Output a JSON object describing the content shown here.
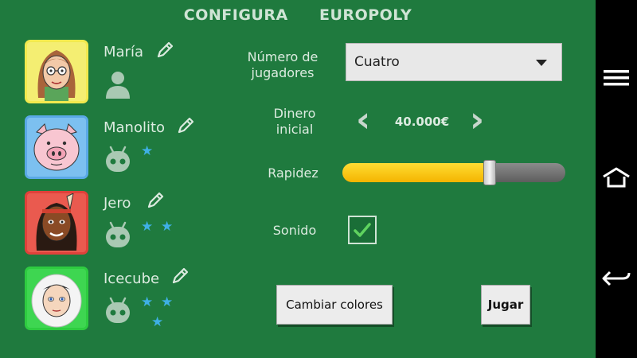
{
  "title": "CONFIGURA   EUROPOLY",
  "players": [
    {
      "name": "María",
      "type": "human",
      "stars": 0,
      "border_color": "#f2e94e"
    },
    {
      "name": "Manolito",
      "type": "cpu",
      "stars": 1,
      "border_color": "#5aa9e6"
    },
    {
      "name": "Jero",
      "type": "cpu",
      "stars": 2,
      "border_color": "#e0413a"
    },
    {
      "name": "Icecube",
      "type": "cpu",
      "stars": 3,
      "border_color": "#2ecc40"
    }
  ],
  "settings": {
    "players_label": "Número de\njugadores",
    "players_value": "Cuatro",
    "money_label": "Dinero\ninicial",
    "money_value": "40.000€",
    "speed_label": "Rapidez",
    "speed_level": 0.66,
    "sound_label": "Sonido",
    "sound_on": true
  },
  "buttons": {
    "change_colors": "Cambiar colores",
    "play": "Jugar"
  },
  "icons": {
    "menu": "hamburger-icon",
    "home": "home-icon",
    "back": "back-icon",
    "edit": "pencil-icon",
    "human": "person-icon",
    "cpu": "android-icon",
    "star": "star-icon"
  },
  "colors": {
    "background": "#1f7a3e",
    "star": "#3fb0e5",
    "slider_fill": "#f4b400"
  }
}
